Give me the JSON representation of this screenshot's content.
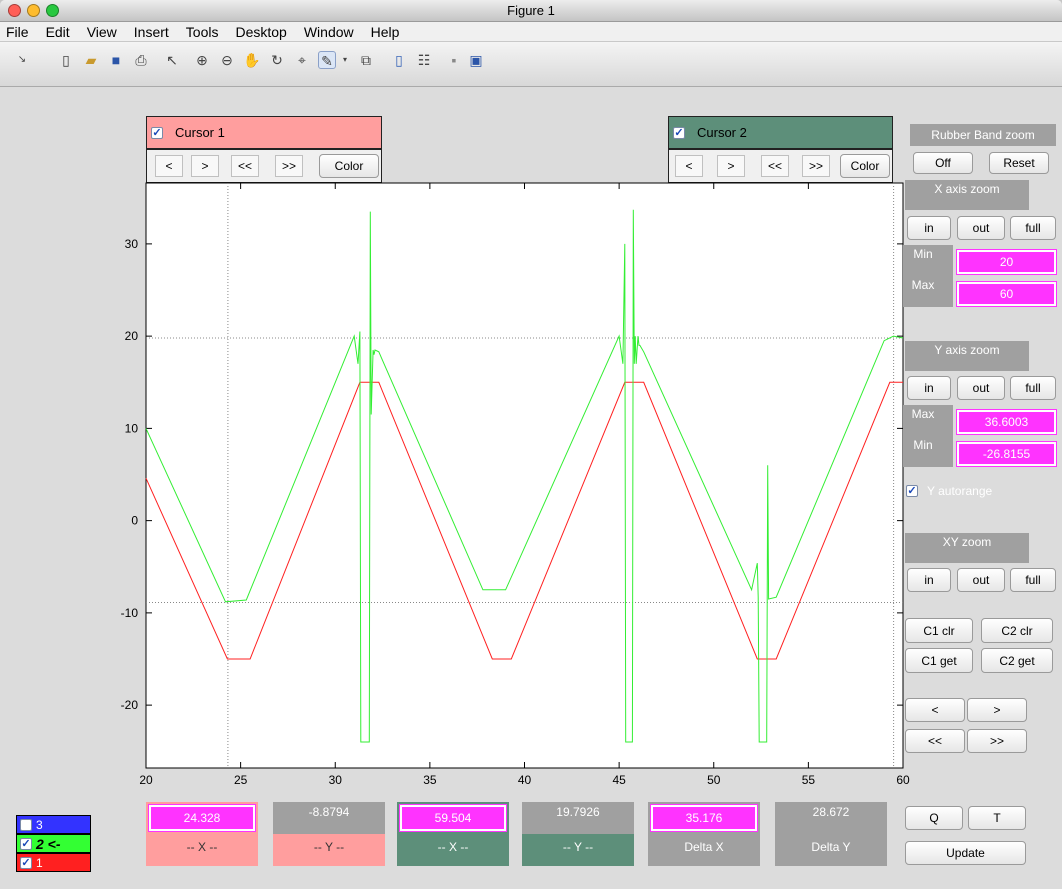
{
  "window": {
    "title": "Figure 1"
  },
  "menu": [
    "File",
    "Edit",
    "View",
    "Insert",
    "Tools",
    "Desktop",
    "Window",
    "Help"
  ],
  "cursor1": {
    "label": "Cursor 1",
    "checked": true,
    "color": "#ff9e9e",
    "buttons": [
      "<",
      ">",
      "<<",
      ">>"
    ],
    "color_button": "Color"
  },
  "cursor2": {
    "label": "Cursor 2",
    "checked": true,
    "color": "#5d8f7a",
    "buttons": [
      "<",
      ">",
      "<<",
      ">>"
    ],
    "color_button": "Color"
  },
  "right": {
    "rubber_band": {
      "title": "Rubber Band zoom",
      "off": "Off",
      "reset": "Reset"
    },
    "x_zoom": {
      "title": "X axis zoom",
      "in": "in",
      "out": "out",
      "full": "full",
      "min_label": "Min",
      "min": "20",
      "max_label": "Max",
      "max": "60"
    },
    "y_zoom": {
      "title": "Y axis zoom",
      "in": "in",
      "out": "out",
      "full": "full",
      "max_label": "Max",
      "max": "36.6003",
      "min_label": "Min",
      "min": "-26.8155"
    },
    "y_autorange": {
      "label": "Y autorange",
      "checked": true
    },
    "xy_zoom": {
      "title": "XY zoom",
      "in": "in",
      "out": "out",
      "full": "full"
    },
    "c1_clr": "C1 clr",
    "c2_clr": "C2 clr",
    "c1_get": "C1 get",
    "c2_get": "C2 get",
    "nav": [
      "<",
      ">",
      "<<",
      ">>"
    ]
  },
  "bottom": {
    "c1_x": "24.328",
    "c1_x_label": "-- X --",
    "c1_y": "-8.8794",
    "c1_y_label": "-- Y --",
    "c2_x": "59.504",
    "c2_x_label": "-- X --",
    "c2_y": "19.7926",
    "c2_y_label": "-- Y --",
    "delta_x": "35.176",
    "delta_x_label": "Delta X",
    "delta_y": "28.672",
    "delta_y_label": "Delta Y",
    "q": "Q",
    "t": "T",
    "update": "Update"
  },
  "traces": [
    {
      "label": "3",
      "checked": false,
      "color": "#3333ff"
    },
    {
      "label": "2 <-",
      "checked": true,
      "color": "#33ff33"
    },
    {
      "label": "1",
      "checked": true,
      "color": "#ff2020"
    }
  ],
  "chart_data": {
    "type": "line",
    "title": "",
    "xlabel": "",
    "ylabel": "",
    "xlim": [
      20,
      60
    ],
    "ylim": [
      -26.8155,
      36.6003
    ],
    "xticks": [
      20,
      25,
      30,
      35,
      40,
      45,
      50,
      55,
      60
    ],
    "yticks": [
      -20,
      -10,
      0,
      10,
      20,
      30
    ],
    "cursor_x": [
      24.328,
      59.504
    ],
    "cursor_y": [
      -8.8794,
      19.7926
    ],
    "series": [
      {
        "color": "#ff2020",
        "x": [
          20,
          24.3,
          25.5,
          31.3,
          32.3,
          38.3,
          39.3,
          45.3,
          46.3,
          52.3,
          53.3,
          59.3,
          60
        ],
        "y": [
          4.6,
          -15,
          -15,
          15,
          15,
          -15,
          -15,
          15,
          15,
          -15,
          -15,
          15,
          15
        ]
      },
      {
        "color": "#33ee33",
        "x": [
          20,
          24.2,
          25.3,
          31.0,
          31.2,
          31.3,
          31.35,
          31.4,
          31.8,
          31.85,
          31.9,
          32.0,
          32.05,
          32.1,
          32.3,
          37.8,
          39.0,
          45.0,
          45.2,
          45.3,
          45.35,
          45.4,
          45.7,
          45.75,
          45.8,
          45.85,
          45.9,
          46.0,
          46.05,
          46.1,
          46.3,
          52.0,
          52.3,
          52.35,
          52.4,
          52.8,
          52.85,
          52.9,
          53.3,
          59.0,
          59.5,
          60
        ],
        "y": [
          10,
          -8.8,
          -8.6,
          20,
          17,
          20.5,
          -24,
          -24,
          -24,
          33.5,
          11.5,
          18.5,
          18,
          18.5,
          18.3,
          -7.5,
          -7.5,
          20,
          17,
          30,
          -24,
          -24,
          -24,
          33.7,
          17,
          20,
          17,
          20,
          19,
          19,
          18.3,
          -7.5,
          -4.6,
          -8.3,
          -24,
          -24,
          6,
          -8.5,
          -8.3,
          19.5,
          20,
          19.8
        ]
      }
    ]
  }
}
